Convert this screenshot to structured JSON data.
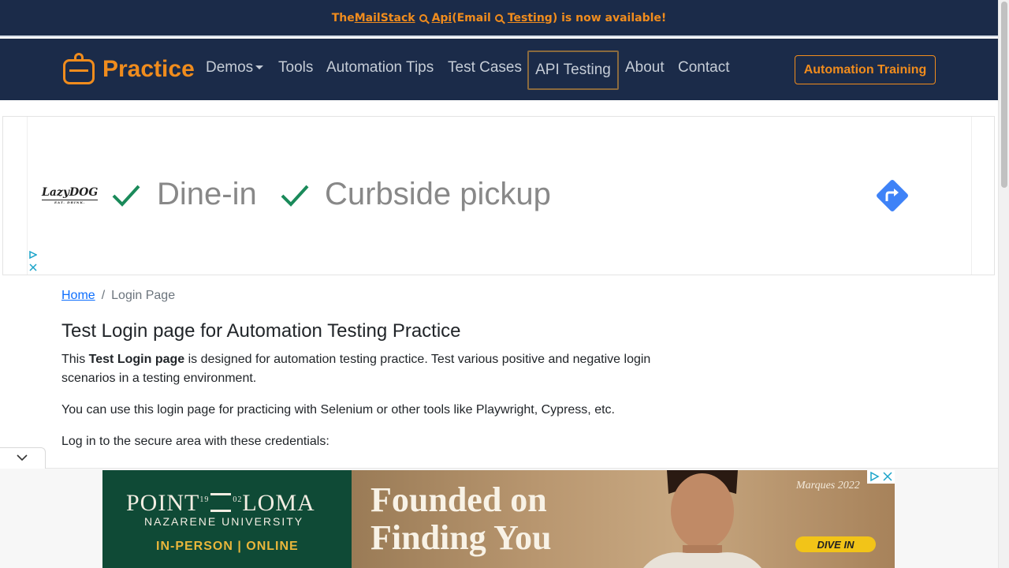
{
  "announcement": {
    "pre": "The ",
    "link1": "MailStack",
    "link2": "Api",
    "mid": " (Email",
    "link3": "Testing",
    "post": ") is now available!"
  },
  "brand": {
    "name": "Practice"
  },
  "nav": {
    "demos": "Demos",
    "tools": "Tools",
    "tips": "Automation Tips",
    "testcases": "Test Cases",
    "api": "API Testing",
    "about": "About",
    "contact": "Contact",
    "training": "Automation Training"
  },
  "ad_top": {
    "brand": "LazyDOG",
    "brand_sub": "EAT. DRINK.",
    "item1": "Dine-in",
    "item2": "Curbside pickup"
  },
  "breadcrumb": {
    "home": "Home",
    "current": "Login Page"
  },
  "page": {
    "title": "Test Login page for Automation Testing Practice",
    "p1_pre": "This ",
    "p1_bold": "Test Login page",
    "p1_post": " is designed for automation testing practice. Test various positive and negative login scenarios in a testing environment.",
    "p2": "You can use this login page for practicing with Selenium or other tools like Playwright, Cypress, etc.",
    "p3": "Log in to the secure area with these credentials:"
  },
  "ad_bottom": {
    "logo_a": "POINT",
    "logo_yr1": "19",
    "logo_yr2": "02",
    "logo_b": "LOMA",
    "university": "NAZARENE UNIVERSITY",
    "modes": "IN-PERSON | ONLINE",
    "headline1": "Founded on",
    "headline2": "Finding You",
    "caption": "Marques 2022",
    "cta": "DIVE IN"
  },
  "colors": {
    "navy": "#1b2b49",
    "accent": "#f08c1d",
    "link": "#0d6efd",
    "ad_green": "#0f4a36"
  }
}
